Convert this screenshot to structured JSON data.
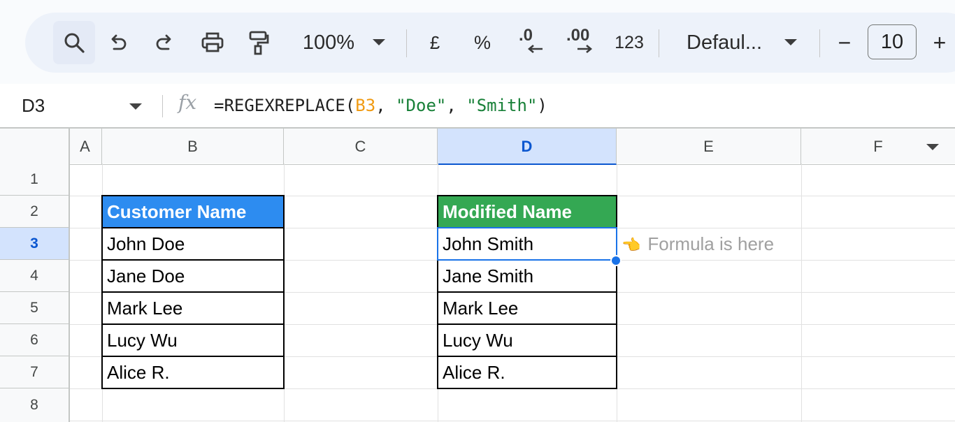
{
  "toolbar": {
    "zoom": "100%",
    "currency": "£",
    "percent": "%",
    "dec_decrease": ".0",
    "dec_increase": ".00",
    "number_format": "123",
    "font_name": "Defaul...",
    "minus": "−",
    "font_size": "10",
    "plus": "+"
  },
  "formula_bar": {
    "cell_ref": "D3",
    "fx": "fx",
    "formula_prefix": "=REGEXREPLACE(",
    "formula_ref": "B3",
    "formula_sep1": ", ",
    "formula_str1": "\"Doe\"",
    "formula_sep2": ", ",
    "formula_str2": "\"Smith\"",
    "formula_suffix": ")"
  },
  "columns": [
    "A",
    "B",
    "C",
    "D",
    "E",
    "F"
  ],
  "rows": [
    "1",
    "2",
    "3",
    "4",
    "5",
    "6",
    "7",
    "8"
  ],
  "selected": {
    "column": "D",
    "row": "3"
  },
  "table_left": {
    "header": "Customer Name",
    "values": [
      "John Doe",
      "Jane Doe",
      "Mark Lee",
      "Lucy Wu",
      "Alice R."
    ]
  },
  "table_right": {
    "header": "Modified Name",
    "values": [
      "John Smith",
      "Jane Smith",
      "Mark Lee",
      "Lucy Wu",
      "Alice R."
    ]
  },
  "note": {
    "hand": "👈",
    "text": "Formula is here"
  },
  "colors": {
    "left_header_bg": "#2d8cf0",
    "right_header_bg": "#34a853",
    "selection": "#1a73e8"
  }
}
